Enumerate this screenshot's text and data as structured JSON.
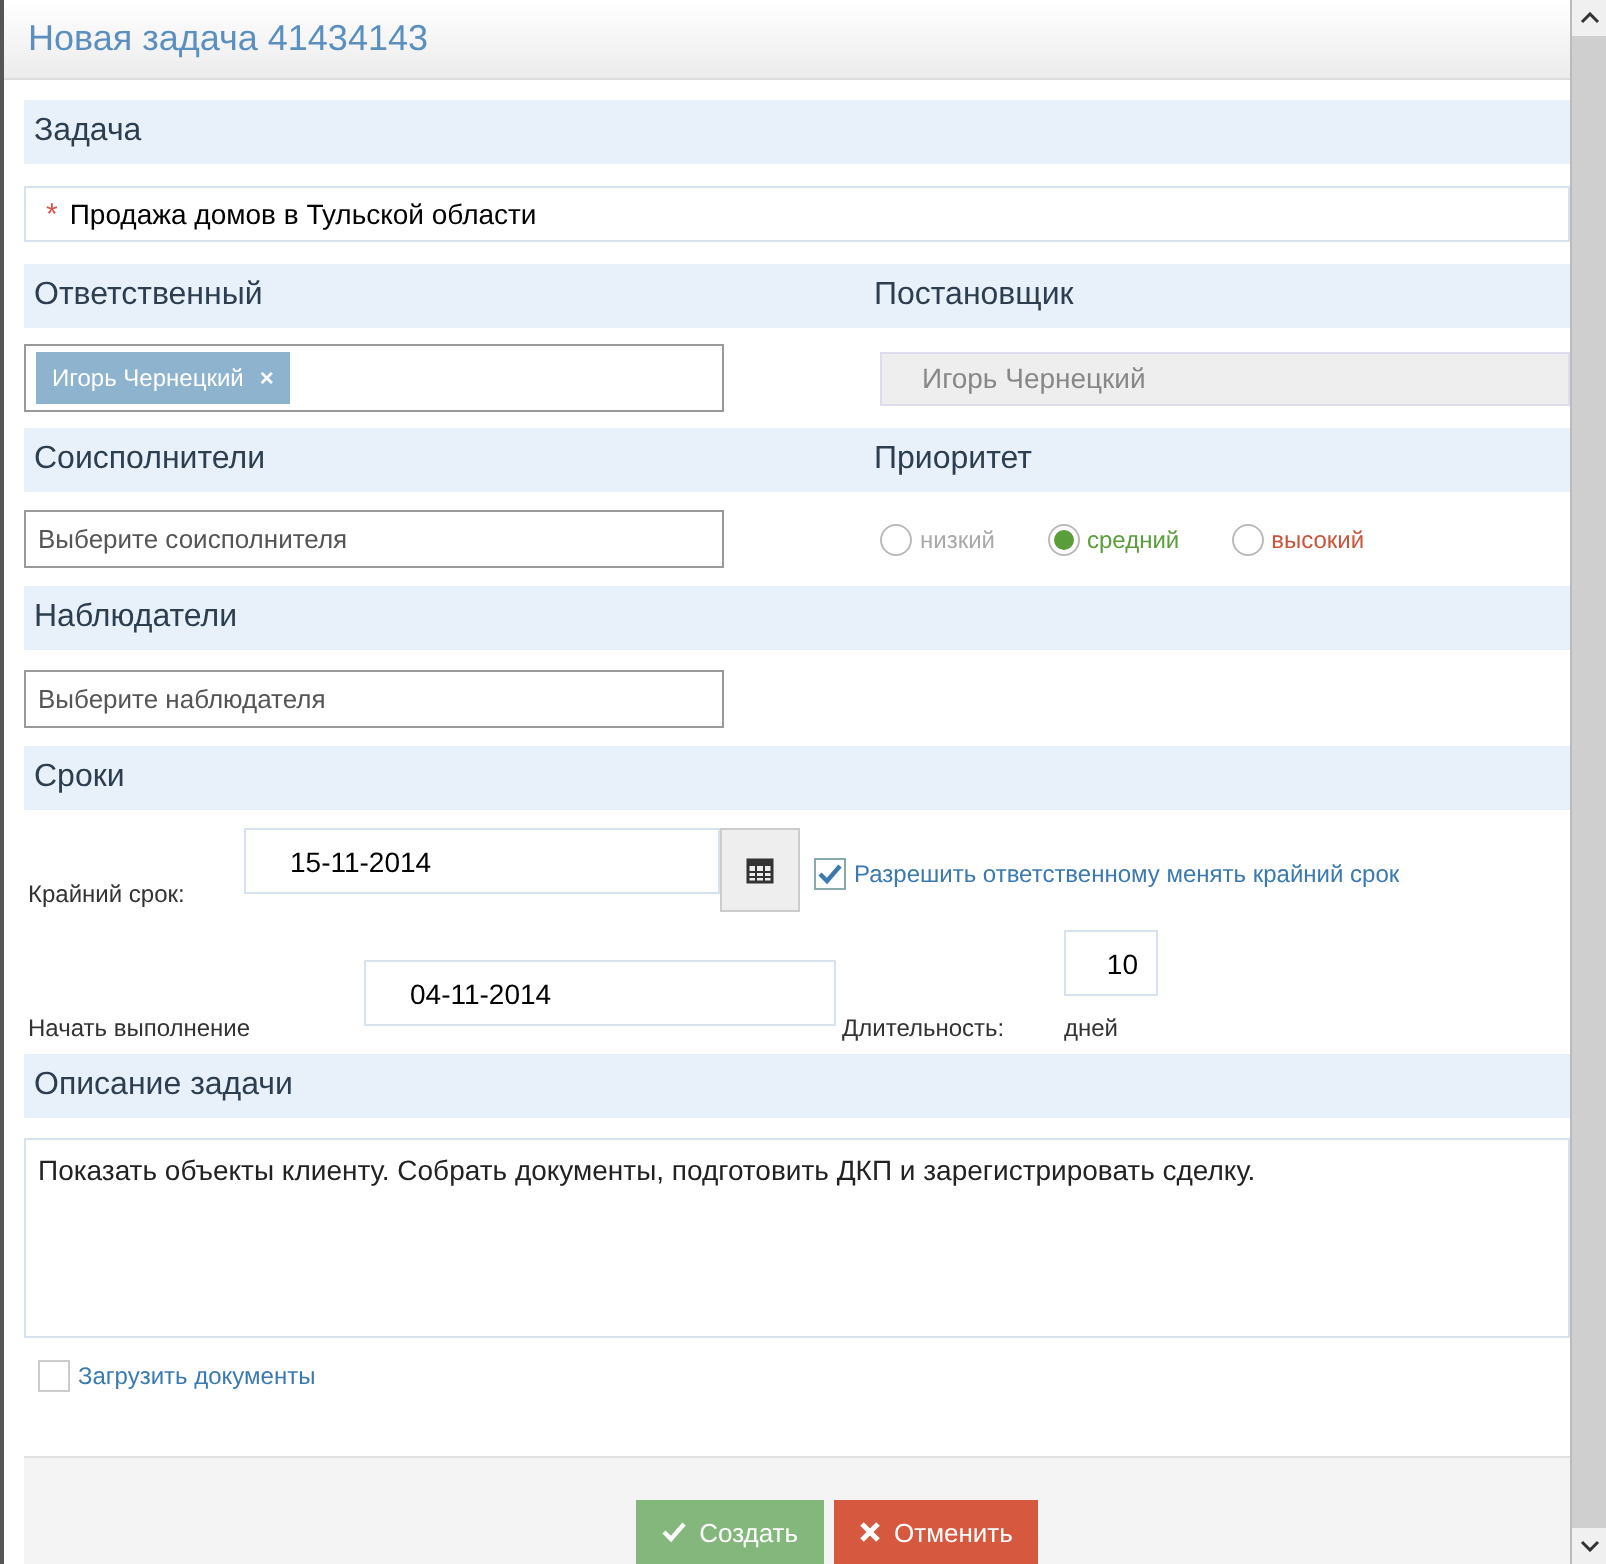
{
  "window": {
    "title": "Новая задача 41434143"
  },
  "task": {
    "header": "Задача",
    "required_mark": "*",
    "value": "Продажа домов в Тульской области"
  },
  "responsible": {
    "header": "Ответственный",
    "tags": [
      {
        "label": "Игорь Чернецкий",
        "remove": "×"
      }
    ]
  },
  "author": {
    "header": "Постановщик",
    "value": "Игорь Чернецкий",
    "disabled": true
  },
  "coexecutors": {
    "header": "Соисполнители",
    "placeholder": "Выберите соисполнителя"
  },
  "priority": {
    "header": "Приоритет",
    "options": [
      {
        "label": "низкий",
        "selected": false,
        "color": "#aaaaaa"
      },
      {
        "label": "средний",
        "selected": true,
        "color": "#5a9e3c"
      },
      {
        "label": "высокий",
        "selected": false,
        "color": "#c9553a"
      }
    ]
  },
  "observers": {
    "header": "Наблюдатели",
    "placeholder": "Выберите наблюдателя"
  },
  "terms": {
    "header": "Сроки",
    "deadline_label": "Крайний срок:",
    "deadline": "15-11-2014",
    "allow_change": {
      "label": "Разрешить ответственному менять крайний срок",
      "checked": true
    },
    "start_label": "Начать выполнение",
    "start": "04-11-2014",
    "duration_label": "Длительность:",
    "duration": "10",
    "duration_unit": "дней"
  },
  "description": {
    "header": "Описание задачи",
    "value": "Показать объекты клиенту. Собрать документы, подготовить ДКП и зарегистрировать сделку."
  },
  "upload": {
    "label": "Загрузить документы",
    "checked": false
  },
  "buttons": [
    {
      "kind": "create",
      "label": "Создать"
    },
    {
      "kind": "cancel",
      "label": "Отменить"
    }
  ]
}
